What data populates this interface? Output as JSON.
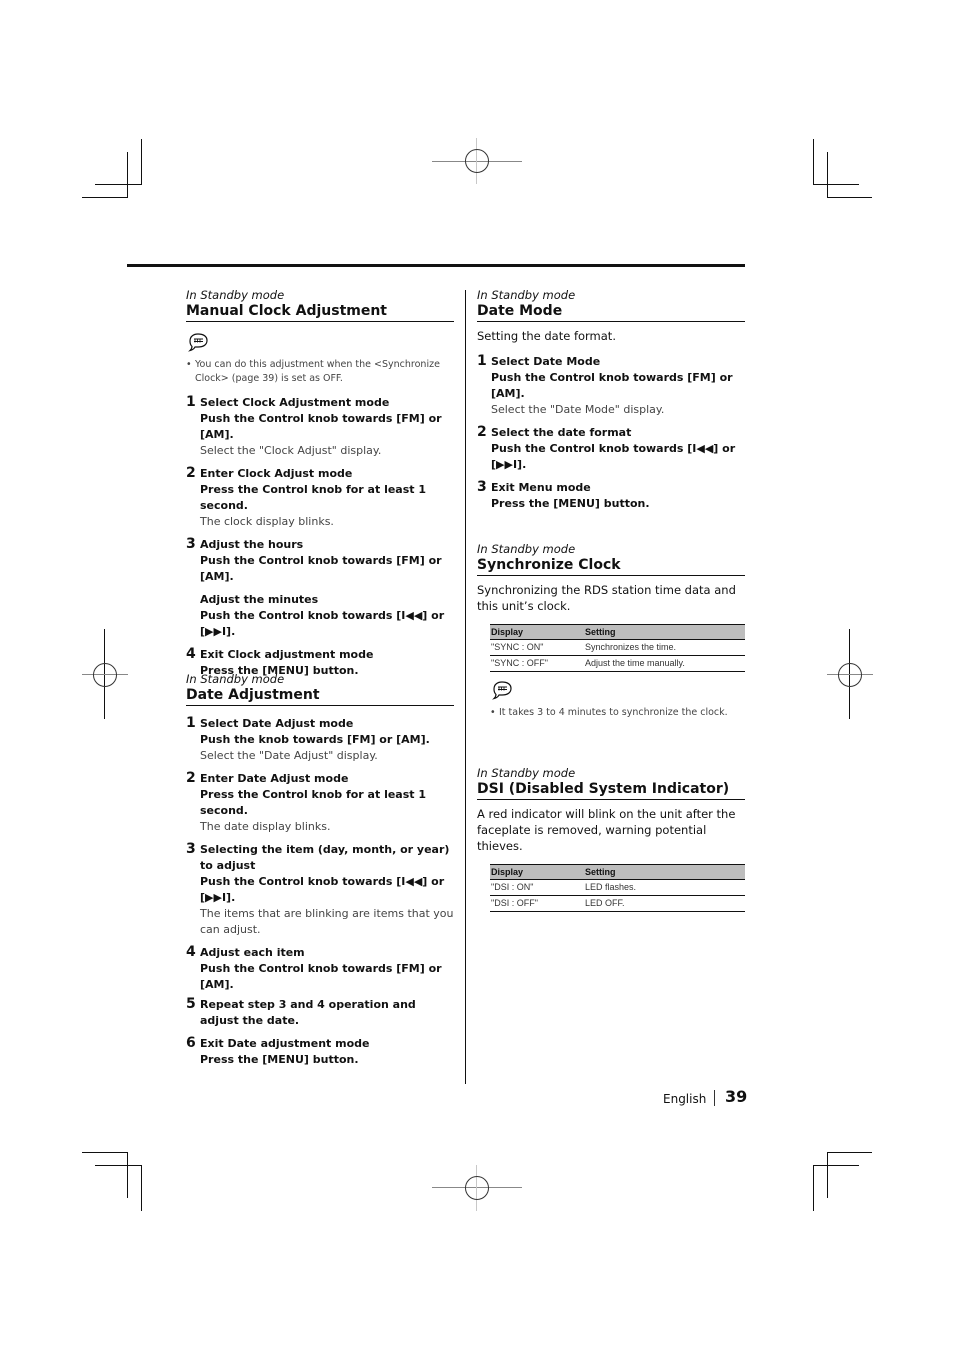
{
  "page": {
    "language": "English",
    "page_number": "39"
  },
  "left_column": {
    "manual_clock": {
      "context": "In Standby mode",
      "title": "Manual Clock Adjustment",
      "note_icon": "note-icon",
      "note": "You can do this adjustment when the <Synchronize Clock> (page 39) is set as OFF.",
      "steps": [
        {
          "num": "1",
          "title": "Select Clock Adjustment mode",
          "action": "Push the Control knob towards [FM] or [AM].",
          "result": "Select the \"Clock Adjust\" display."
        },
        {
          "num": "2",
          "title": "Enter Clock Adjust mode",
          "action": "Press the Control knob for at least 1 second.",
          "result": "The clock display blinks."
        },
        {
          "num": "3",
          "title": "Adjust the hours",
          "action": "Push the Control knob towards [FM] or [AM].",
          "sub_title": "Adjust the minutes",
          "sub_action": "Push the Control knob towards [I◀◀] or [▶▶I]."
        },
        {
          "num": "4",
          "title": "Exit Clock adjustment mode",
          "action": "Press the [MENU] button."
        }
      ]
    },
    "date_adjust": {
      "context": "In Standby mode",
      "title": "Date Adjustment",
      "steps": [
        {
          "num": "1",
          "title": "Select Date Adjust mode",
          "action": "Push the knob towards [FM] or [AM].",
          "result": "Select the \"Date Adjust\" display."
        },
        {
          "num": "2",
          "title": "Enter Date Adjust mode",
          "action": "Press the Control knob for at least 1 second.",
          "result": "The date display blinks."
        },
        {
          "num": "3",
          "title": "Selecting the item (day, month, or year) to adjust",
          "action": "Push the Control knob towards [I◀◀] or [▶▶I].",
          "result": "The items that are blinking are items that you can adjust."
        },
        {
          "num": "4",
          "title": "Adjust each item",
          "action": "Push the Control knob towards [FM] or [AM]."
        },
        {
          "num": "5",
          "title": "Repeat step 3 and 4 operation and adjust the date."
        },
        {
          "num": "6",
          "title": "Exit Date adjustment mode",
          "action": "Press the [MENU] button."
        }
      ]
    }
  },
  "right_column": {
    "date_mode": {
      "context": "In Standby mode",
      "title": "Date Mode",
      "intro": "Setting the date format.",
      "steps": [
        {
          "num": "1",
          "title": "Select Date Mode",
          "action": "Push the Control knob towards [FM] or [AM].",
          "result": "Select the \"Date Mode\" display."
        },
        {
          "num": "2",
          "title": "Select the date format",
          "action": "Push the Control knob towards [I◀◀] or [▶▶I]."
        },
        {
          "num": "3",
          "title": "Exit Menu mode",
          "action": "Press the [MENU] button."
        }
      ]
    },
    "sync_clock": {
      "context": "In Standby mode",
      "title": "Synchronize Clock",
      "intro": "Synchronizing the RDS station time data and this unit’s clock.",
      "table": {
        "headers": [
          "Display",
          "Setting"
        ],
        "rows": [
          [
            "\"SYNC : ON\"",
            "Synchronizes the time."
          ],
          [
            "\"SYNC : OFF\"",
            "Adjust the time manually."
          ]
        ]
      },
      "note_icon": "note-icon",
      "note": "It takes 3 to 4 minutes to synchronize the clock."
    },
    "dsi": {
      "context": "In Standby mode",
      "title": "DSI (Disabled System Indicator)",
      "intro": "A red indicator will blink on the unit after the faceplate is removed, warning potential thieves.",
      "table": {
        "headers": [
          "Display",
          "Setting"
        ],
        "rows": [
          [
            "\"DSI : ON\"",
            "LED flashes."
          ],
          [
            "\"DSI : OFF\"",
            "LED OFF."
          ]
        ]
      }
    }
  }
}
